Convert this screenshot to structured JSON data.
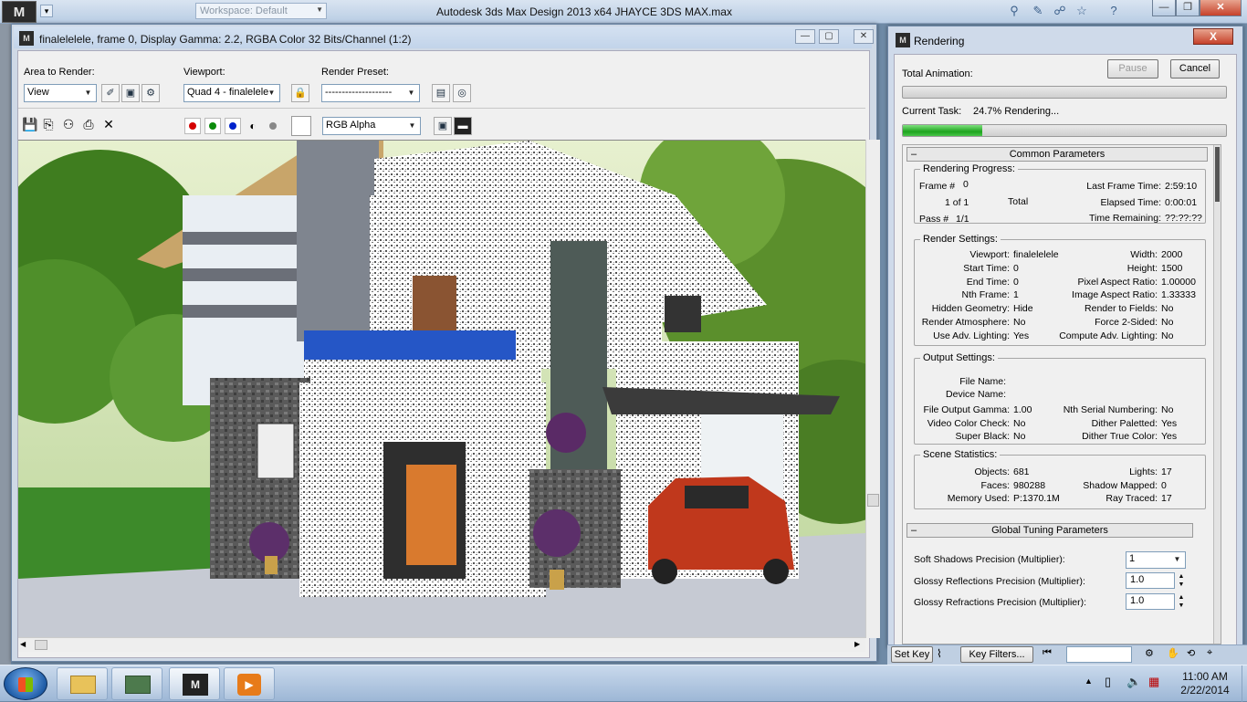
{
  "app": {
    "logo": "M",
    "workspace": "Workspace: Default",
    "title": "Autodesk 3ds Max Design 2013 x64      JHAYCE 3DS MAX.max"
  },
  "frame_window": {
    "icon": "M",
    "title": "finalelelele, frame 0, Display Gamma: 2.2, RGBA Color 32 Bits/Channel (1:2)",
    "area_label": "Area to Render:",
    "area_value": "View",
    "viewport_label": "Viewport:",
    "viewport_value": "Quad 4 - finalelele",
    "preset_label": "Render Preset:",
    "preset_value": "--------------------",
    "channel_value": "RGB Alpha"
  },
  "rendering": {
    "icon": "M",
    "title": "Rendering",
    "close": "X",
    "total_animation": "Total Animation:",
    "pause": "Pause",
    "cancel": "Cancel",
    "current_task_label": "Current Task:",
    "current_task_value": "24.7%  Rendering...",
    "progress_fraction": 0.247,
    "common_params": "Common Parameters",
    "progress": {
      "title": "Rendering Progress:",
      "frame_label": "Frame #",
      "frame_value": "0",
      "of_value": "1 of 1",
      "total": "Total",
      "pass_label": "Pass #",
      "pass_value": "1/1",
      "last_frame_label": "Last Frame Time:",
      "last_frame_value": "2:59:10",
      "elapsed_label": "Elapsed Time:",
      "elapsed_value": "0:00:01",
      "remaining_label": "Time Remaining:",
      "remaining_value": "??:??:??"
    },
    "render_settings": {
      "title": "Render Settings:",
      "left": [
        {
          "k": "Viewport:",
          "v": "finalelelele"
        },
        {
          "k": "Start Time:",
          "v": "0"
        },
        {
          "k": "End Time:",
          "v": "0"
        },
        {
          "k": "Nth Frame:",
          "v": "1"
        },
        {
          "k": "Hidden Geometry:",
          "v": "Hide"
        },
        {
          "k": "Render Atmosphere:",
          "v": "No"
        },
        {
          "k": "Use Adv. Lighting:",
          "v": "Yes"
        }
      ],
      "right": [
        {
          "k": "Width:",
          "v": "2000"
        },
        {
          "k": "Height:",
          "v": "1500"
        },
        {
          "k": "Pixel Aspect Ratio:",
          "v": "1.00000"
        },
        {
          "k": "Image Aspect Ratio:",
          "v": "1.33333"
        },
        {
          "k": "Render to Fields:",
          "v": "No"
        },
        {
          "k": "Force 2-Sided:",
          "v": "No"
        },
        {
          "k": "Compute Adv. Lighting:",
          "v": "No"
        }
      ]
    },
    "output_settings": {
      "title": "Output Settings:",
      "file_name": "File Name:",
      "device_name": "Device Name:",
      "left": [
        {
          "k": "File Output Gamma:",
          "v": "1.00"
        },
        {
          "k": "Video Color Check:",
          "v": "No"
        },
        {
          "k": "Super Black:",
          "v": "No"
        }
      ],
      "right": [
        {
          "k": "Nth Serial Numbering:",
          "v": "No"
        },
        {
          "k": "Dither Paletted:",
          "v": "Yes"
        },
        {
          "k": "Dither True Color:",
          "v": "Yes"
        }
      ]
    },
    "scene_stats": {
      "title": "Scene Statistics:",
      "left": [
        {
          "k": "Objects:",
          "v": "681"
        },
        {
          "k": "Faces:",
          "v": "980288"
        },
        {
          "k": "Memory Used:",
          "v": "P:1370.1M"
        }
      ],
      "right": [
        {
          "k": "Lights:",
          "v": "17"
        },
        {
          "k": "Shadow Mapped:",
          "v": "0"
        },
        {
          "k": "Ray Traced:",
          "v": "17"
        }
      ]
    },
    "global_tuning": "Global Tuning Parameters",
    "soft_shadows_label": "Soft Shadows Precision (Multiplier):",
    "soft_shadows_value": "1",
    "glossy_refl_label": "Glossy Reflections Precision (Multiplier):",
    "glossy_refl_value": "1.0",
    "glossy_refr_label": "Glossy Refractions Precision (Multiplier):",
    "glossy_refr_value": "1.0"
  },
  "behind": {
    "set_key": "Set Key",
    "key_filters": "Key Filters..."
  },
  "taskbar": {
    "time": "11:00 AM",
    "date": "2/22/2014"
  }
}
